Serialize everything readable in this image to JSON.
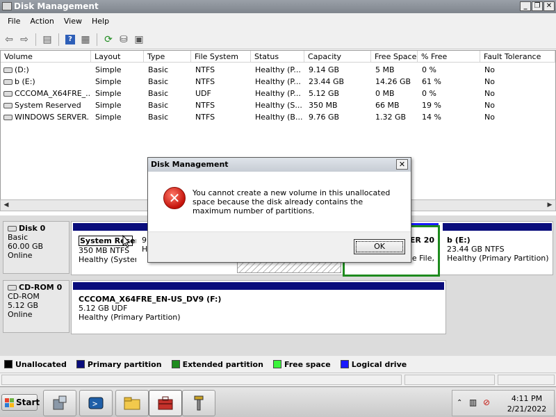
{
  "window": {
    "title": "Disk Management"
  },
  "menubar": {
    "items": [
      "File",
      "Action",
      "View",
      "Help"
    ]
  },
  "volume_table": {
    "columns": [
      "Volume",
      "Layout",
      "Type",
      "File System",
      "Status",
      "Capacity",
      "Free Space",
      "% Free",
      "Fault Tolerance"
    ],
    "rows": [
      [
        "(D:)",
        "Simple",
        "Basic",
        "NTFS",
        "Healthy (P...",
        "9.14 GB",
        "5 MB",
        "0 %",
        "No"
      ],
      [
        "b (E:)",
        "Simple",
        "Basic",
        "NTFS",
        "Healthy (P...",
        "23.44 GB",
        "14.26 GB",
        "61 %",
        "No"
      ],
      [
        "CCCOMA_X64FRE_...",
        "Simple",
        "Basic",
        "UDF",
        "Healthy (P...",
        "5.12 GB",
        "0 MB",
        "0 %",
        "No"
      ],
      [
        "System Reserved",
        "Simple",
        "Basic",
        "NTFS",
        "Healthy (S...",
        "350 MB",
        "66 MB",
        "19 %",
        "No"
      ],
      [
        "WINDOWS SERVER...",
        "Simple",
        "Basic",
        "NTFS",
        "Healthy (B...",
        "9.76 GB",
        "1.32 GB",
        "14 %",
        "No"
      ]
    ]
  },
  "disks": {
    "disk0": {
      "name": "Disk 0",
      "type": "Basic",
      "size": "60.00 GB",
      "status": "Online",
      "system_reserved": {
        "title": "System Reserved",
        "line2": "350 MB NTFS",
        "line3": "Healthy (System"
      },
      "part_d": {
        "line2": "9.",
        "line3": "He"
      },
      "windows_server": {
        "title": "ER 20",
        "line3": "e File,"
      },
      "part_e": {
        "title": "b  (E:)",
        "line2": "23.44 GB NTFS",
        "line3": "Healthy (Primary Partition)"
      }
    },
    "cdrom0": {
      "name": "CD-ROM 0",
      "type": "CD-ROM",
      "size": "5.12 GB",
      "status": "Online",
      "part": {
        "title": "CCCOMA_X64FRE_EN-US_DV9  (F:)",
        "line2": "5.12 GB UDF",
        "line3": "Healthy (Primary Partition)"
      }
    }
  },
  "legend": {
    "items": [
      {
        "label": "Unallocated",
        "color": "#000000"
      },
      {
        "label": "Primary partition",
        "color": "#0a0d7c"
      },
      {
        "label": "Extended partition",
        "color": "#1e8b1e"
      },
      {
        "label": "Free space",
        "color": "#3bf53b"
      },
      {
        "label": "Logical drive",
        "color": "#1a1aff"
      }
    ]
  },
  "dialog": {
    "title": "Disk Management",
    "message": "You cannot create a new volume in this unallocated space because the disk already contains the maximum number of partitions.",
    "ok_label": "OK"
  },
  "taskbar": {
    "start_label": "Start",
    "time": "4:11 PM",
    "date": "2/21/2022",
    "apps": [
      "server-manager-icon",
      "powershell-icon",
      "explorer-icon",
      "computer-management-icon",
      "tools-icon"
    ]
  }
}
